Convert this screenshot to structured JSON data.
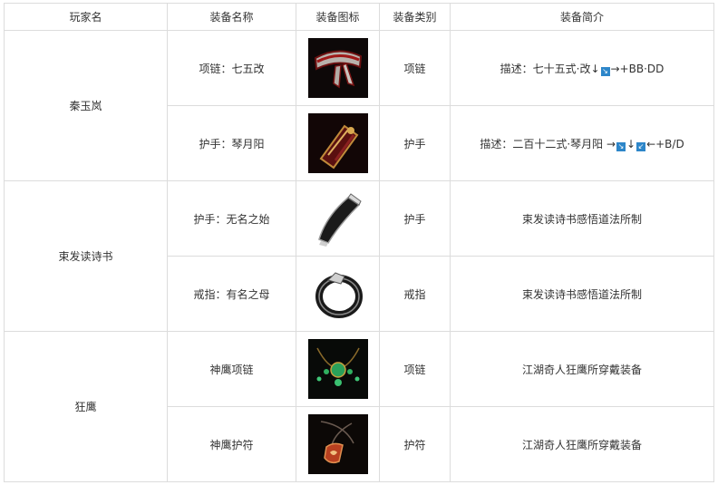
{
  "headers": {
    "player": "玩家名",
    "name": "装备名称",
    "icon": "装备图标",
    "category": "装备类别",
    "desc": "装备简介"
  },
  "players": [
    "秦玉岚",
    "束发读诗书",
    "狂鹰"
  ],
  "rows": [
    {
      "name": "项链：七五改",
      "icon": "headband-icon",
      "category": "项链",
      "desc_prefix": "描述：七十五式·改↓",
      "desc_key1": "↘",
      "desc_suffix": "→+BB·DD"
    },
    {
      "name": "护手：琴月阳",
      "icon": "gauntlet-icon",
      "category": "护手",
      "desc_prefix": "描述：二百十二式·琴月阳 →",
      "desc_key1": "↘",
      "desc_mid": "↓",
      "desc_key2": "↙",
      "desc_suffix": "←+B/D"
    },
    {
      "name": "护手：无名之始",
      "icon": "bracer-icon",
      "category": "护手",
      "desc": "束发读诗书感悟道法所制"
    },
    {
      "name": "戒指：有名之母",
      "icon": "ring-icon",
      "category": "戒指",
      "desc": "束发读诗书感悟道法所制"
    },
    {
      "name": "神鹰项链",
      "icon": "jade-necklace-icon",
      "category": "项链",
      "desc": "江湖奇人狂鹰所穿戴装备"
    },
    {
      "name": "神鹰护符",
      "icon": "amulet-icon",
      "category": "护符",
      "desc": "江湖奇人狂鹰所穿戴装备"
    }
  ]
}
